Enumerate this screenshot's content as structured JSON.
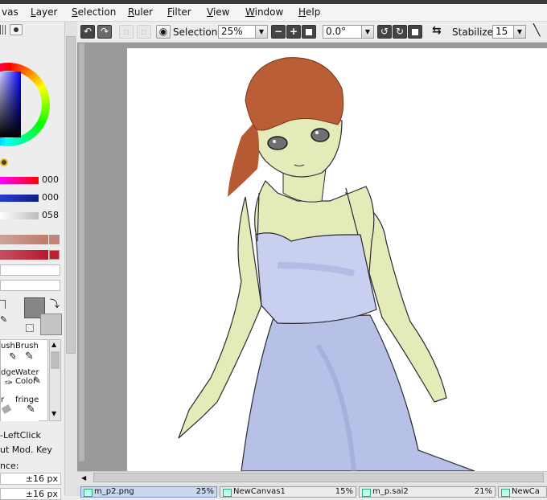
{
  "menu": {
    "items": [
      {
        "label": "vas",
        "underline": ""
      },
      {
        "label": "ayer",
        "underline": "L"
      },
      {
        "label": "election",
        "underline": "S"
      },
      {
        "label": "uler",
        "underline": "R"
      },
      {
        "label": "ilter",
        "underline": "F"
      },
      {
        "label": "iew",
        "underline": "V"
      },
      {
        "label": "indow",
        "underline": "W"
      },
      {
        "label": "elp",
        "underline": "H"
      }
    ]
  },
  "toolbar": {
    "selection_label": "Selection",
    "zoom_value": "25%",
    "rotation_value": "0.0°",
    "stabilizer_label": "Stabilizer",
    "stabilizer_value": "15"
  },
  "color_panel": {
    "slider_values": [
      "000",
      "000",
      "058"
    ],
    "accent_colors": [
      "#d3002a",
      "#0a1f86",
      "#c9c9c9"
    ]
  },
  "tool_panel": {
    "tools": [
      {
        "label": "ush"
      },
      {
        "label": "Brush"
      },
      {
        "label": "dge"
      },
      {
        "label": "Water Color"
      },
      {
        "label": "r"
      },
      {
        "label": "fringe"
      }
    ],
    "option_texts": [
      "-LeftClick",
      "ut Mod. Key"
    ],
    "distance_label": "nce:",
    "size_values": [
      "±16 px",
      "±16 px"
    ]
  },
  "tabs": [
    {
      "label": "m_p2.png",
      "percent": "25%"
    },
    {
      "label": "NewCanvas1",
      "percent": "15%"
    },
    {
      "label": "m_p.sai2",
      "percent": "21%"
    },
    {
      "label": "NewCa",
      "percent": ""
    }
  ]
}
